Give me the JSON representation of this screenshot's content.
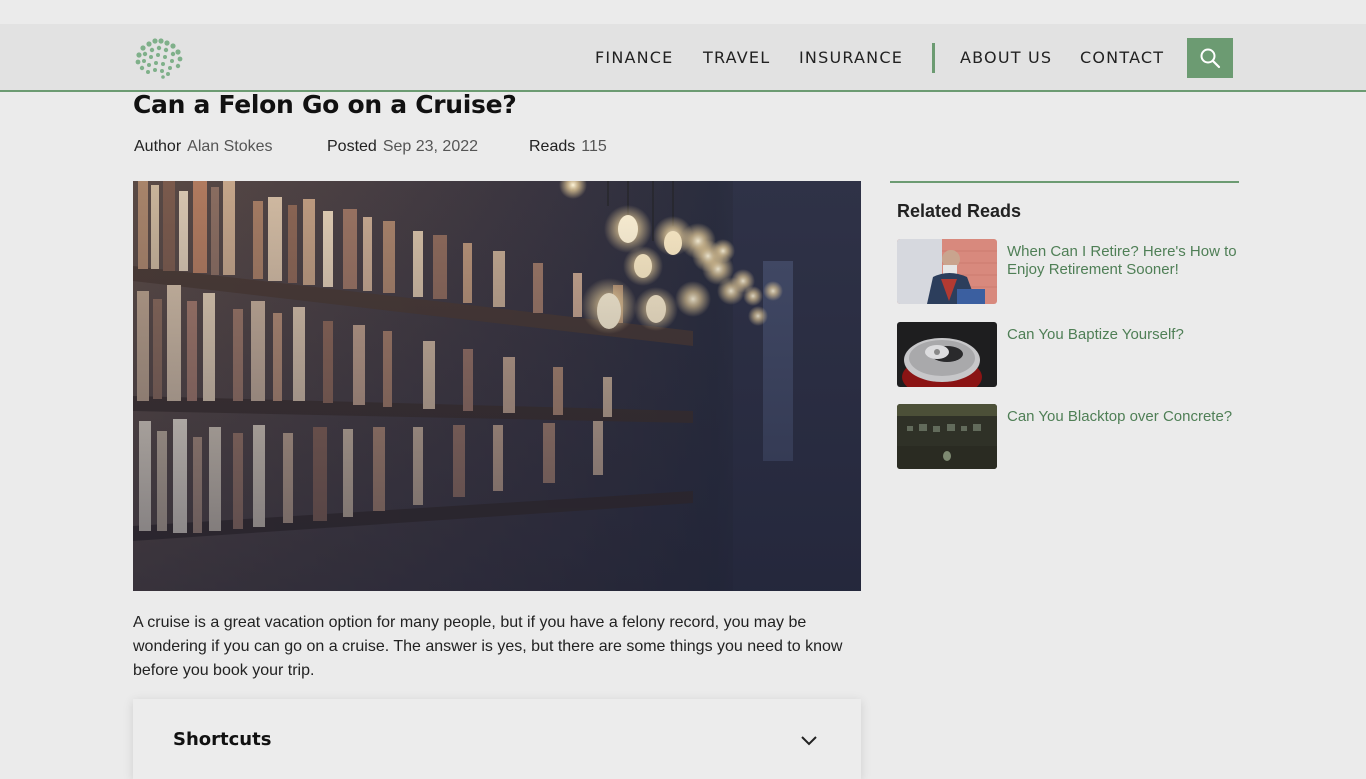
{
  "nav": {
    "links": [
      "FINANCE",
      "TRAVEL",
      "INSURANCE"
    ],
    "secondary_links": [
      "ABOUT US",
      "CONTACT"
    ],
    "search_icon": "search-icon"
  },
  "article": {
    "title": "Can a Felon Go on a Cruise?",
    "meta": {
      "author_label": "Author",
      "author": "Alan Stokes",
      "posted_label": "Posted",
      "posted": "Sep 23, 2022",
      "reads_label": "Reads",
      "reads": "115"
    },
    "intro": "A cruise is a great vacation option for many people, but if you have a felony record, you may be wondering if you can go on a cruise. The answer is yes, but there are some things you need to know before you book your trip.",
    "shortcuts_label": "Shortcuts"
  },
  "sidebar": {
    "title": "Related Reads",
    "items": [
      {
        "text": "When Can I Retire? Here's How to Enjoy Retirement Sooner!"
      },
      {
        "text": "Can You Baptize Yourself?"
      },
      {
        "text": "Can You Blacktop over Concrete?"
      }
    ]
  },
  "colors": {
    "accent": "#6c9b72",
    "link": "#4f7f56",
    "background": "#ebebeb"
  }
}
